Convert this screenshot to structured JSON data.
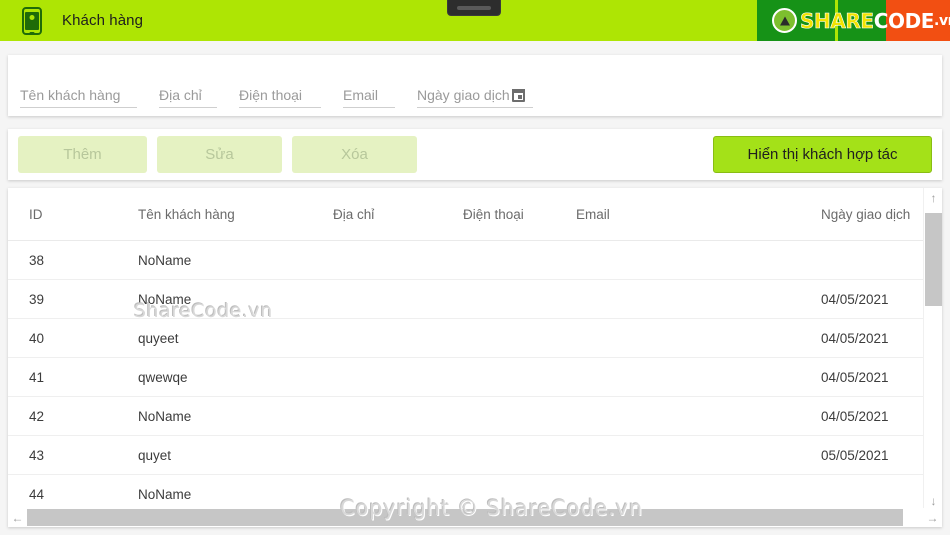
{
  "appbar": {
    "title": "Khách hàng",
    "phone_icon": "mobile-phone-icon",
    "notch": "device-speaker"
  },
  "logo": {
    "share": "SHARE",
    "code": "CODE",
    "vn": ".vn",
    "mark": "recycle-icon",
    "colors": {
      "green": "#169217",
      "orange": "#f24f12",
      "yellow": "#f2e300"
    }
  },
  "filters": [
    {
      "name": "ten-khach-hang",
      "placeholder": "Tên khách hàng",
      "value": ""
    },
    {
      "name": "dia-chi",
      "placeholder": "Địa chỉ",
      "value": ""
    },
    {
      "name": "dien-thoai",
      "placeholder": "Điện thoại",
      "value": ""
    },
    {
      "name": "email",
      "placeholder": "Email",
      "value": ""
    },
    {
      "name": "ngay-giao-dich",
      "placeholder": "Ngày giao dịch",
      "value": "",
      "icon": "calendar-icon"
    }
  ],
  "toolbar": {
    "add_label": "Thêm",
    "edit_label": "Sửa",
    "delete_label": "Xóa",
    "show_partners_label": "Hiển thị khách hợp tác",
    "accent": "#a4e118",
    "disabled_bg": "#e5f2c2"
  },
  "table": {
    "columns": [
      "ID",
      "Tên khách hàng",
      "Địa chỉ",
      "Điện thoại",
      "Email",
      "Ngày giao dịch"
    ],
    "rows": [
      {
        "id": "38",
        "name": "NoName",
        "address": "",
        "phone": "",
        "email": "",
        "date": ""
      },
      {
        "id": "39",
        "name": "NoName",
        "address": "",
        "phone": "",
        "email": "",
        "date": "04/05/2021"
      },
      {
        "id": "40",
        "name": "quyeet",
        "address": "",
        "phone": "",
        "email": "",
        "date": "04/05/2021"
      },
      {
        "id": "41",
        "name": "qwewqe",
        "address": "",
        "phone": "",
        "email": "",
        "date": "04/05/2021"
      },
      {
        "id": "42",
        "name": "NoName",
        "address": "",
        "phone": "",
        "email": "",
        "date": "04/05/2021"
      },
      {
        "id": "43",
        "name": "quyet",
        "address": "",
        "phone": "",
        "email": "",
        "date": "05/05/2021"
      },
      {
        "id": "44",
        "name": "NoName",
        "address": "",
        "phone": "",
        "email": "",
        "date": ""
      }
    ]
  },
  "scrollbars": {
    "up_arrow": "↑",
    "down_arrow": "↓",
    "left_arrow": "←",
    "right_arrow": "→"
  },
  "watermarks": {
    "primary": "ShareCode.vn",
    "copyright": "Copyright © ShareCode.vn"
  }
}
